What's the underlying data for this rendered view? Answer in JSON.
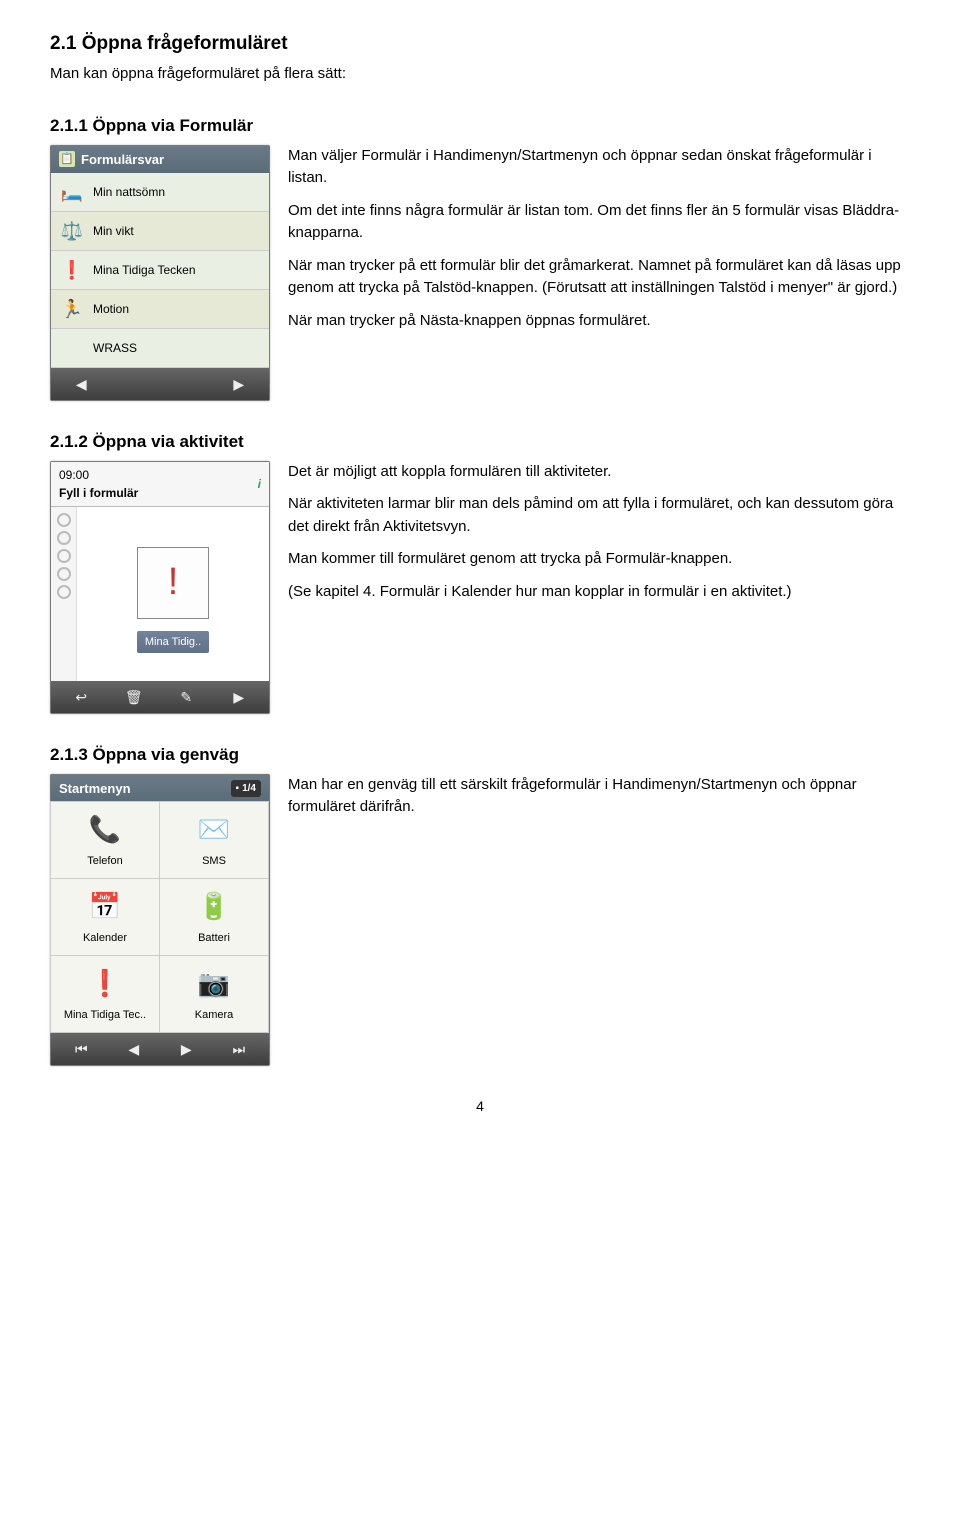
{
  "h_2_1": "2.1 Öppna frågeformuläret",
  "intro_2_1": "Man kan öppna frågeformuläret på flera sätt:",
  "h_2_1_1": "2.1.1 Öppna via Formulär",
  "p_2_1_1": [
    "Man väljer Formulär i Handimenyn/Startmenyn och öppnar sedan önskat frågeformulär i listan.",
    "Om det inte finns några formulär är listan tom. Om det finns fler än 5 formulär visas Bläddra-knapparna.",
    "När man trycker på ett formulär blir det gråmarkerat. Namnet på formuläret kan då läsas upp genom att trycka på Talstöd-knappen. (Förutsatt att inställningen Talstöd i menyer\" är gjord.)",
    "När man trycker på Nästa-knappen öppnas formuläret."
  ],
  "phone1": {
    "title": "Formulärsvar",
    "items": [
      {
        "icon": "🛏️",
        "label": "Min nattsömn"
      },
      {
        "icon": "⚖️",
        "label": "Min vikt"
      },
      {
        "icon": "❗",
        "label": "Mina Tidiga Tecken"
      },
      {
        "icon": "🏃",
        "label": "Motion"
      },
      {
        "icon": "",
        "label": "WRASS"
      }
    ]
  },
  "h_2_1_2": "2.1.2 Öppna via aktivitet",
  "p_2_1_2": [
    "Det är möjligt att koppla formulären till aktiviteter.",
    "När aktiviteten larmar blir man dels påmind om att fylla i formuläret, och kan dessutom göra det direkt från Aktivitetsvyn.",
    "Man kommer till formuläret genom att trycka på Formulär-knappen.",
    "(Se kapitel 4. Formulär i Kalender hur man kopplar in formulär i en aktivitet.)"
  ],
  "phone2": {
    "time": "09:00",
    "title": "Fyll i formulär",
    "info_icon": "i",
    "reminder": "!",
    "caption": "Mina Tidig.."
  },
  "h_2_1_3": "2.1.3 Öppna via genväg",
  "p_2_1_3": [
    "Man har en genväg till ett särskilt frågeformulär i Handimenyn/Startmenyn och öppnar formuläret därifrån."
  ],
  "phone3": {
    "title": "Startmenyn",
    "page": "1/4",
    "cells": [
      {
        "icon": "📞",
        "label": "Telefon"
      },
      {
        "icon": "✉️",
        "label": "SMS"
      },
      {
        "icon": "📅",
        "label": "Kalender"
      },
      {
        "icon": "🔋",
        "label": "Batteri"
      },
      {
        "icon": "❗",
        "label": "Mina Tidiga Tec.."
      },
      {
        "icon": "📷",
        "label": "Kamera"
      }
    ]
  },
  "pagenum": "4"
}
